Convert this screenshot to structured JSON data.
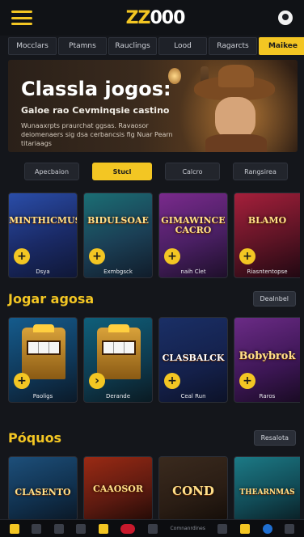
{
  "header": {
    "logo": "ZZ000",
    "menu_icon": "hamburger-menu-icon",
    "user_icon": "user-avatar-icon"
  },
  "tabs": [
    {
      "label": "Mocclars"
    },
    {
      "label": "Ptamns"
    },
    {
      "label": "Rauclings"
    },
    {
      "label": "Lood"
    },
    {
      "label": "Ragarcts"
    },
    {
      "label": "Maikee",
      "active": true
    }
  ],
  "hero": {
    "title": "Classla jogos:",
    "subtitle": "Galoe rao Cevminqsie castino",
    "description": "Wunaaxrpts praurchat ggsas. Ravaosor deiomenaers sig dsa cerbancsis fig Nuar Pearn titariaags"
  },
  "filters": [
    {
      "label": "Apecbaion"
    },
    {
      "label": "Stucl",
      "active": true
    },
    {
      "label": "Calcro"
    },
    {
      "label": "Rangsirea"
    }
  ],
  "row1": {
    "games": [
      {
        "art": "MINTHICMUS",
        "name": "Dsya"
      },
      {
        "art": "BIDULSOAE",
        "name": "Exmbgsck"
      },
      {
        "art": "GIMAWINCE CACRO",
        "name": "naih Clet"
      },
      {
        "art": "BLAMO",
        "name": "Riasntentopse"
      }
    ]
  },
  "section2": {
    "title": "Jogar agosa",
    "see_all": "Dealnbel",
    "games": [
      {
        "art": "",
        "name": "Paoligs"
      },
      {
        "art": "",
        "name": "Derande"
      },
      {
        "art": "CLASBALCK",
        "name": "Ceal Run"
      },
      {
        "art": "Bobybrok",
        "name": "Raros"
      }
    ]
  },
  "section3": {
    "title": "Póquos",
    "see_all": "Resalota",
    "games": [
      {
        "art": "CLASENTO",
        "name": ""
      },
      {
        "art": "CAAOSOR",
        "name": ""
      },
      {
        "art": "COND",
        "name": ""
      },
      {
        "art": "THEARNMAS",
        "name": ""
      }
    ]
  },
  "bottom_bar": {
    "text": "Comnanrdines",
    "icons": [
      "home-icon",
      "grid-icon",
      "chat-icon",
      "support-icon",
      "trophy-icon",
      "live-icon",
      "clock-icon",
      "check-icon",
      "wallet-icon",
      "cards-icon",
      "shield-icon",
      "globe-icon",
      "settings-icon"
    ]
  },
  "colors": {
    "accent": "#f3c623",
    "background": "#14161b"
  }
}
